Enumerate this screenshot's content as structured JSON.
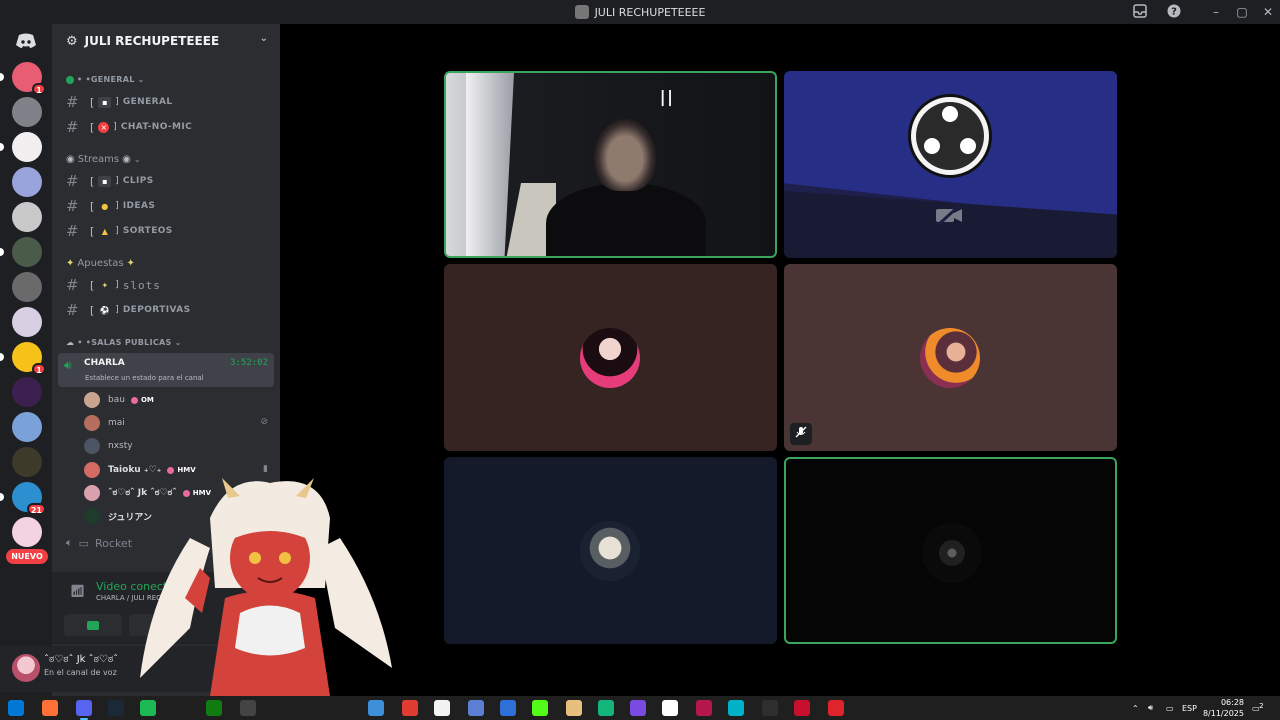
{
  "window": {
    "title": "JULI RECHUPETEEEE"
  },
  "rail": {
    "servers": [
      {
        "color": "#e85d74",
        "badge": "1"
      },
      {
        "color": "#808289",
        "badge": ""
      },
      {
        "color": "#f1eff0",
        "badge": ""
      },
      {
        "color": "#9aa4dc",
        "badge": ""
      },
      {
        "color": "#c9c9c9",
        "badge": ""
      },
      {
        "color": "#4b5b4a",
        "badge": ""
      },
      {
        "color": "#6a6a6a",
        "badge": ""
      },
      {
        "color": "#d8cfe3",
        "badge": ""
      },
      {
        "color": "#f6c21a",
        "badge": "1"
      },
      {
        "color": "#3b1f4f",
        "badge": ""
      },
      {
        "color": "#7aa2d8",
        "badge": ""
      },
      {
        "color": "#3e3a2a",
        "badge": ""
      },
      {
        "color": "#2c8fd0",
        "badge": "21"
      },
      {
        "color": "#f3d3e0",
        "badge": ""
      }
    ],
    "new_label": "NUEVO"
  },
  "sidebar": {
    "guild_name": "JULI RECHUPETEEEE",
    "cat_general": "• •GENERAL",
    "ch_general": "GENERAL",
    "ch_chat_no_mic": "CHAT-NO-MIC",
    "cat_streams": "Streams",
    "ch_clips": "CLIPS",
    "ch_ideas": "IDEAS",
    "ch_sorteos": "SORTEOS",
    "cat_apuestas": "Apuestas",
    "ch_slots": "slots",
    "ch_deportivas": "DEPORTIVAS",
    "cat_salas": "• •SALAS PUBLICAS",
    "voice_channel": {
      "name": "CHARLA",
      "timer": "3:52:02",
      "status_placeholder": "Establece un estado para el canal"
    },
    "members": [
      {
        "name": "bau",
        "tag": "OM",
        "color": "#c9a48f"
      },
      {
        "name": "mai",
        "tag": "",
        "color": "#b66f5f"
      },
      {
        "name": "nxsty",
        "tag": "",
        "color": "#4d5565"
      },
      {
        "name": "Taioku ₊♡₊",
        "tag": "HMV",
        "color": "#d46a64"
      },
      {
        "name": "ˆಠ♡ಠˆ Jk ˆಠ♡ಠˆ",
        "tag": "HMV",
        "color": "#d9a1ad"
      },
      {
        "name": "ジュリアン",
        "tag": "",
        "color": "#1f3b2b"
      }
    ],
    "ch_rocket": "Rocket"
  },
  "voice_panel": {
    "status": "Video conectado",
    "location": "CHARLA / JULI RECHUPETE"
  },
  "user_panel": {
    "username": "ˆಠ♡ಠˆ Jk ˆಠ♡ಠˆ",
    "status": "En el canal de voz"
  },
  "taskbar": {
    "language": "ESP",
    "time": "06:28",
    "date": "8/11/2025",
    "notifications": "2",
    "apps": [
      {
        "color": "#0078d4"
      },
      {
        "color": "#ff7139"
      },
      {
        "color": "#5865f2",
        "active": true
      },
      {
        "color": "#1b2838"
      },
      {
        "color": "#1db954"
      },
      {
        "color": "#107c10"
      },
      {
        "color": "#444444"
      },
      {
        "color": "#3d8fd8"
      },
      {
        "color": "#e03c31"
      },
      {
        "color": "#f2f2f2"
      },
      {
        "color": "#5c7fd6"
      },
      {
        "color": "#2f6fd8"
      },
      {
        "color": "#53fc18"
      },
      {
        "color": "#e8c07d"
      },
      {
        "color": "#13b57a"
      },
      {
        "color": "#7b4ae2"
      },
      {
        "color": "#ffffff"
      },
      {
        "color": "#b3174e"
      },
      {
        "color": "#00b2c8"
      },
      {
        "color": "#302e31"
      },
      {
        "color": "#c8102e"
      },
      {
        "color": "#e0242b"
      }
    ]
  }
}
